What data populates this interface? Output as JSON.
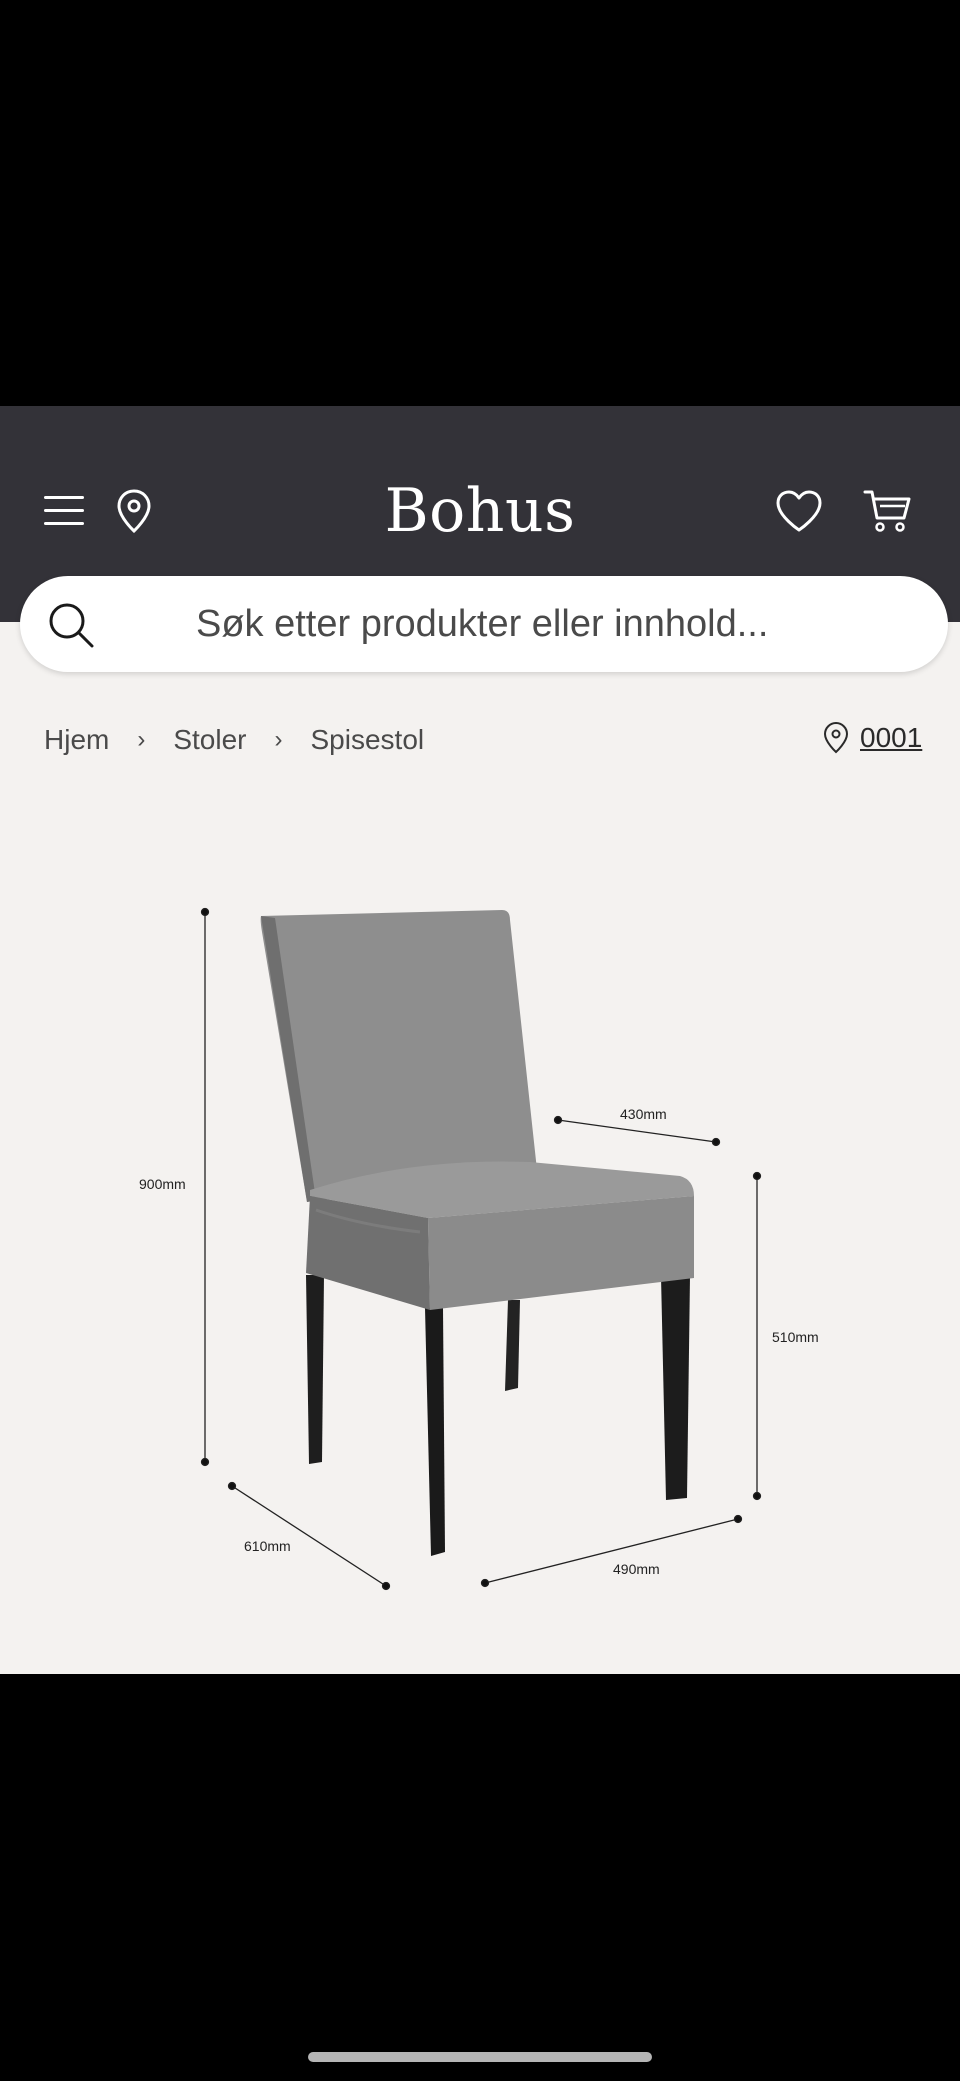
{
  "header": {
    "logo": "Bohus",
    "icons": {
      "menu": "menu-icon",
      "location": "location-pin-icon",
      "favorites": "heart-icon",
      "cart": "cart-icon"
    }
  },
  "search": {
    "placeholder": "Søk etter produkter eller innhold..."
  },
  "breadcrumb": {
    "items": [
      "Hjem",
      "Stoler",
      "Spisestol"
    ],
    "separator": "›"
  },
  "store": {
    "code": "0001"
  },
  "product_image": {
    "dimensions": {
      "height": "900mm",
      "depth": "610mm",
      "width": "490mm",
      "seat_depth": "430mm",
      "seat_height": "510mm"
    }
  },
  "colors": {
    "header_bg": "#333238",
    "content_bg": "#f4f2f0",
    "chair_fabric": "#8a8a8a",
    "chair_legs": "#1e1e1e"
  }
}
